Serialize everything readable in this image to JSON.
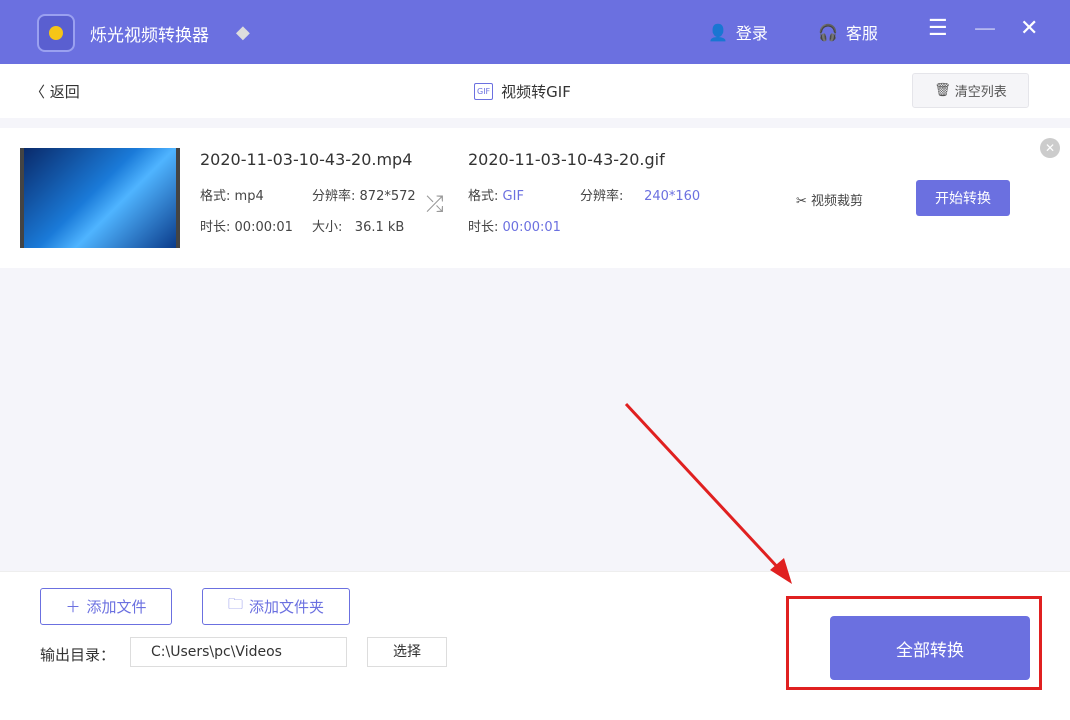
{
  "app": {
    "title": "烁光视频转换器",
    "login": "登录",
    "service": "客服"
  },
  "sub": {
    "back": "返回",
    "title": "视频转GIF",
    "gif_icon": "GIF",
    "clear": "清空列表"
  },
  "item": {
    "src_name": "2020-11-03-10-43-20.mp4",
    "src_format_label": "格式:",
    "src_format": "mp4",
    "src_res_label": "分辨率:",
    "src_res": "872*572",
    "src_dur_label": "时长:",
    "src_dur": "00:00:01",
    "size_label": "大小:",
    "size": "36.1 kB",
    "dst_name": "2020-11-03-10-43-20.gif",
    "dst_format_label": "格式:",
    "dst_format": "GIF",
    "dst_res_label": "分辨率:",
    "dst_res": "240*160",
    "dst_dur_label": "时长:",
    "dst_dur": "00:00:01",
    "trim": "视频裁剪",
    "start": "开始转换"
  },
  "footer": {
    "add_file": "添加文件",
    "add_folder": "添加文件夹",
    "output_label": "输出目录：",
    "output_path": "C:\\Users\\pc\\Videos",
    "choose": "选择",
    "convert_all": "全部转换"
  },
  "colors": {
    "accent": "#6b70e0",
    "annotation": "#e02020"
  }
}
